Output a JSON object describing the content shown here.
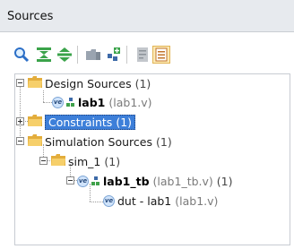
{
  "panel": {
    "title": "Sources"
  },
  "toolbar": {
    "buttons": [
      "search",
      "collapse-all",
      "expand-all",
      "add-sources",
      "hierarchy-add",
      "properties",
      "show-hierarchy"
    ]
  },
  "tree": {
    "design_sources": {
      "label": "Design Sources",
      "count": "(1)"
    },
    "lab1": {
      "name": "lab1",
      "file": "(lab1.v)"
    },
    "constraints": {
      "label": "Constraints",
      "count": "(1)"
    },
    "simulation_sources": {
      "label": "Simulation Sources",
      "count": "(1)"
    },
    "sim_1": {
      "label": "sim_1",
      "count": "(1)"
    },
    "lab1_tb": {
      "name": "lab1_tb",
      "file": "(lab1_tb.v)",
      "count": "(1)"
    },
    "dut": {
      "name": "dut - lab1",
      "file": "(lab1.v)"
    }
  },
  "colors": {
    "selection": "#3d7fd9",
    "title_bg": "#e7eaee",
    "folder": "#f2c14e"
  }
}
